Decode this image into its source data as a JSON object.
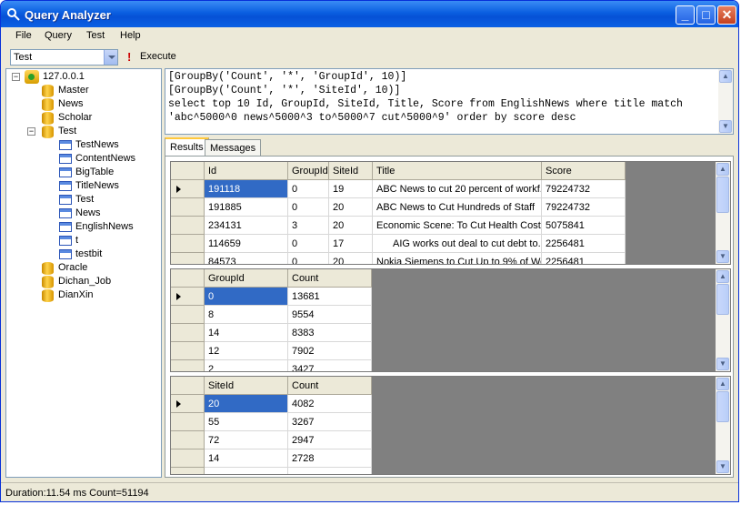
{
  "window": {
    "title": "Query Analyzer"
  },
  "menu": [
    "File",
    "Query",
    "Test",
    "Help"
  ],
  "toolbar": {
    "database": "Test",
    "execute_label": "Execute"
  },
  "tree": {
    "server": "127.0.0.1",
    "databases": [
      "Master",
      "News",
      "Scholar",
      "Test"
    ],
    "test_tables": [
      "TestNews",
      "ContentNews",
      "BigTable",
      "TitleNews",
      "Test",
      "News",
      "EnglishNews",
      "t",
      "testbit"
    ],
    "other_databases": [
      "Oracle",
      "Dichan_Job",
      "DianXin"
    ]
  },
  "editor": {
    "lines": [
      "[GroupBy('Count', '*', 'GroupId', 10)]",
      "[GroupBy('Count', '*', 'SiteId', 10)]",
      "select top 10 Id, GroupId, SiteId, Title, Score from EnglishNews where title match",
      "'abc^5000^0 news^5000^3 to^5000^7 cut^5000^9' order by score desc"
    ]
  },
  "tabs": [
    "Results",
    "Messages"
  ],
  "grid1": {
    "columns": [
      "Id",
      "GroupId",
      "SiteId",
      "Title",
      "Score"
    ],
    "rows": [
      [
        "191118",
        "0",
        "19",
        "ABC News to cut 20 percent of workf...",
        "79224732"
      ],
      [
        "191885",
        "0",
        "20",
        "ABC News to Cut Hundreds of Staff",
        "79224732"
      ],
      [
        "234131",
        "3",
        "20",
        "Economic Scene: To Cut Health Cost...",
        "5075841"
      ],
      [
        "114659",
        "0",
        "17",
        "AIG works out deal to cut debt to...",
        "2256481"
      ],
      [
        "84573",
        "0",
        "20",
        "Nokia Siemens to Cut Up to 9% of Wo...",
        "2256481"
      ]
    ]
  },
  "grid2": {
    "columns": [
      "GroupId",
      "Count"
    ],
    "rows": [
      [
        "0",
        "13681"
      ],
      [
        "8",
        "9554"
      ],
      [
        "14",
        "8383"
      ],
      [
        "12",
        "7902"
      ],
      [
        "2",
        "3427"
      ]
    ]
  },
  "grid3": {
    "columns": [
      "SiteId",
      "Count"
    ],
    "rows": [
      [
        "20",
        "4082"
      ],
      [
        "55",
        "3267"
      ],
      [
        "72",
        "2947"
      ],
      [
        "14",
        "2728"
      ],
      [
        "",
        ""
      ]
    ]
  },
  "status": {
    "text": "Duration:11.54 ms Count=51194"
  }
}
